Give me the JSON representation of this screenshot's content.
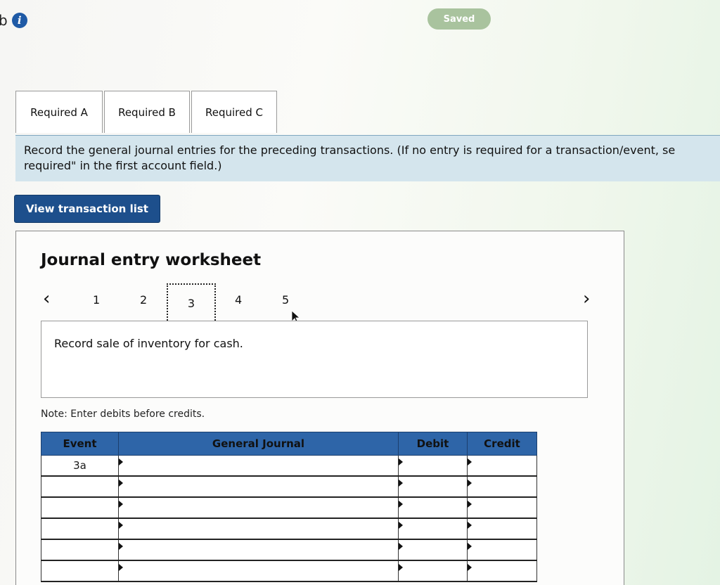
{
  "header": {
    "left_fragment": "b",
    "saved_label": "Saved"
  },
  "tabs": [
    {
      "label": "Required A"
    },
    {
      "label": "Required B"
    },
    {
      "label": "Required C"
    }
  ],
  "instruction": {
    "line1": "Record the general journal entries for the preceding transactions. (If no entry is required for a transaction/event, se",
    "line2": "required\" in the first account field.)"
  },
  "view_button_label": "View transaction list",
  "worksheet": {
    "title": "Journal entry worksheet",
    "prev_icon": "chevron-left-icon",
    "next_icon": "chevron-right-icon",
    "pages": [
      "1",
      "2",
      "3",
      "4",
      "5"
    ],
    "current_page": "3",
    "description": "Record sale of inventory for cash.",
    "note": "Note: Enter debits before credits."
  },
  "table": {
    "headers": [
      "Event",
      "General Journal",
      "Debit",
      "Credit"
    ],
    "rows": [
      {
        "event": "3a",
        "account": "",
        "debit": "",
        "credit": ""
      },
      {
        "event": "",
        "account": "",
        "debit": "",
        "credit": ""
      },
      {
        "event": "",
        "account": "",
        "debit": "",
        "credit": ""
      },
      {
        "event": "",
        "account": "",
        "debit": "",
        "credit": ""
      },
      {
        "event": "",
        "account": "",
        "debit": "",
        "credit": ""
      },
      {
        "event": "",
        "account": "",
        "debit": "",
        "credit": ""
      }
    ]
  },
  "colors": {
    "header_blue": "#2e65a8",
    "button_blue": "#1d4f8c",
    "instruction_bg": "#d4e5ed",
    "saved_pill": "#a9c39e"
  }
}
